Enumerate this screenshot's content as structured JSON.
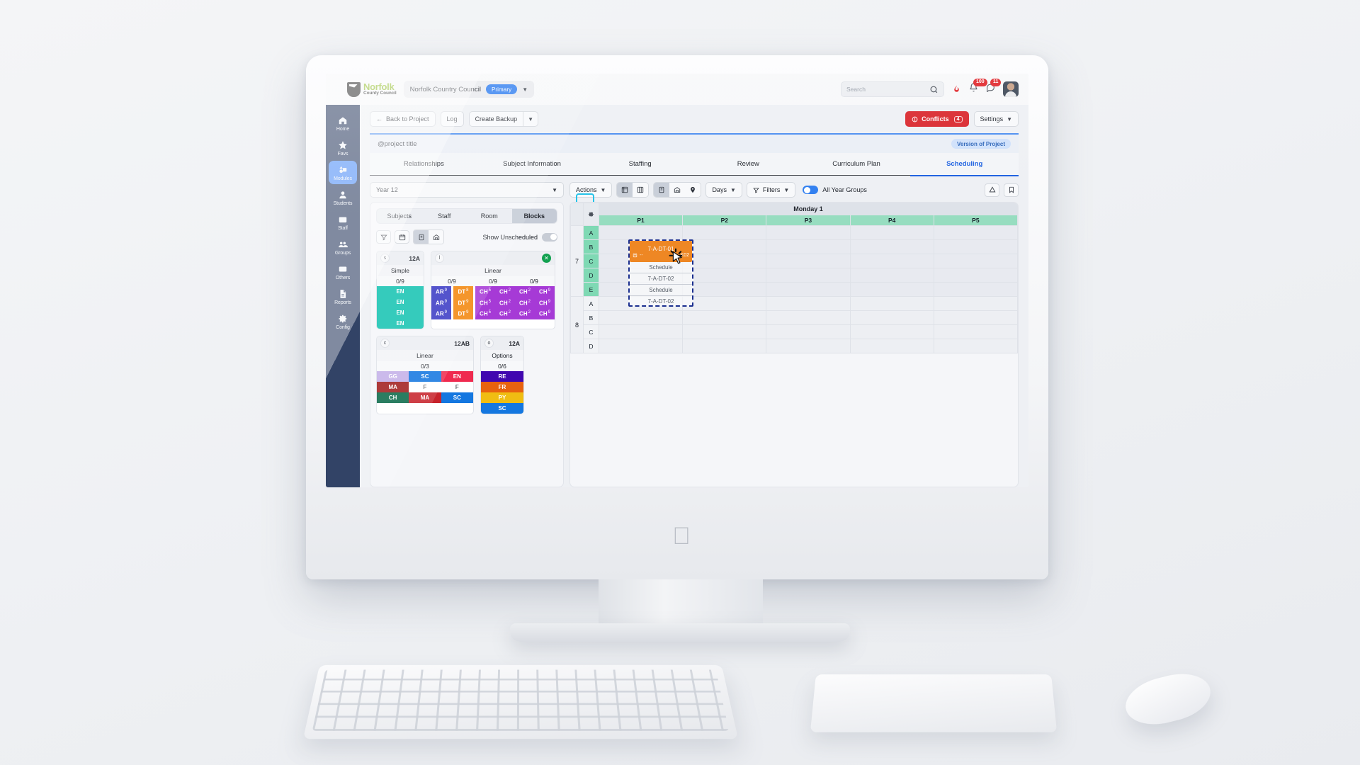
{
  "header": {
    "brand_top": "Norfolk",
    "brand_sub": "County Council",
    "org_name": "Norfolk Country Council",
    "org_badge": "Primary",
    "search_placeholder": "Search",
    "notifications_count": "100",
    "messages_count": "11"
  },
  "sidebar": {
    "items": [
      {
        "label": "Home",
        "icon": "home-icon"
      },
      {
        "label": "Favs",
        "icon": "star-icon"
      },
      {
        "label": "Modules",
        "icon": "modules-icon"
      },
      {
        "label": "Students",
        "icon": "student-icon"
      },
      {
        "label": "Staff",
        "icon": "staff-icon"
      },
      {
        "label": "Groups",
        "icon": "groups-icon"
      },
      {
        "label": "Others",
        "icon": "others-icon"
      },
      {
        "label": "Reports",
        "icon": "report-icon"
      },
      {
        "label": "Config",
        "icon": "gear-icon"
      }
    ],
    "active_index": 2
  },
  "actionbar": {
    "back_label": "Back to Project",
    "log_label": "Log",
    "backup_label": "Create Backup",
    "conflicts_label": "Conflicts",
    "conflicts_count": "4",
    "settings_label": "Settings"
  },
  "project": {
    "title": "@project title",
    "version_label": "Version of Project"
  },
  "tabs": {
    "items": [
      "Relationships",
      "Subject Information",
      "Staffing",
      "Review",
      "Curriculum Plan",
      "Scheduling"
    ],
    "active_index": 5
  },
  "left_panel": {
    "year_select": "Year 12",
    "segments": [
      "Subjects",
      "Staff",
      "Room",
      "Blocks"
    ],
    "segment_active_index": 3,
    "show_unscheduled_label": "Show Unscheduled",
    "show_unscheduled_on": false,
    "blocks": [
      {
        "mark": "S",
        "code": "12A",
        "type": "Simple",
        "counts": [
          "0/9"
        ],
        "closable": false,
        "columns": 1,
        "rows": [
          [
            {
              "text": "EN",
              "color": "#17c3b2"
            }
          ],
          [
            {
              "text": "EN",
              "color": "#17c3b2"
            }
          ],
          [
            {
              "text": "EN",
              "color": "#17c3b2"
            }
          ],
          [
            {
              "text": "EN",
              "color": "#17c3b2"
            }
          ]
        ]
      },
      {
        "mark": "L",
        "code": "",
        "type": "Linear",
        "counts": [
          "0/9",
          "0/9",
          "0/9"
        ],
        "closable": true,
        "columns": 6,
        "rows": [
          [
            {
              "text": "AR",
              "sup": "9",
              "color": "#3b3bc4"
            },
            {
              "text": "DT",
              "sup": "8",
              "color": "#f2860d"
            },
            {
              "text": "CH",
              "sup": "5",
              "color": "#a63ad6"
            },
            {
              "text": "CH",
              "sup": "2",
              "color": "#a63ad6"
            },
            {
              "text": "CH",
              "sup": "2",
              "color": "#a63ad6"
            },
            {
              "text": "CH",
              "sup": "9",
              "color": "#a63ad6"
            }
          ],
          [
            {
              "text": "AR",
              "sup": "9",
              "color": "#3b3bc4"
            },
            {
              "text": "DT",
              "sup": "9",
              "color": "#f2860d"
            },
            {
              "text": "CH",
              "sup": "5",
              "color": "#a63ad6"
            },
            {
              "text": "CH",
              "sup": "2",
              "color": "#a63ad6"
            },
            {
              "text": "CH",
              "sup": "2",
              "color": "#a63ad6"
            },
            {
              "text": "CH",
              "sup": "9",
              "color": "#a63ad6"
            }
          ],
          [
            {
              "text": "AR",
              "sup": "9",
              "color": "#3b3bc4"
            },
            {
              "text": "DT",
              "sup": "9",
              "color": "#f2860d"
            },
            {
              "text": "CH",
              "sup": "5",
              "color": "#a63ad6"
            },
            {
              "text": "CH",
              "sup": "2",
              "color": "#a63ad6"
            },
            {
              "text": "CH",
              "sup": "2",
              "color": "#a63ad6"
            },
            {
              "text": "CH",
              "sup": "9",
              "color": "#a63ad6"
            }
          ]
        ]
      },
      {
        "mark": "C",
        "code": "12AB",
        "type": "Linear",
        "counts": [
          "0/3"
        ],
        "closable": false,
        "columns": 3,
        "rows": [
          [
            {
              "text": "GG",
              "color": "#c3b0e8"
            },
            {
              "text": "SC",
              "color": "#1477e0"
            },
            {
              "text": "EN",
              "color": "#ef2a4f"
            }
          ],
          [
            {
              "text": "MA",
              "color": "#a11d1d"
            },
            {
              "text": "F",
              "color": "#ffffff"
            },
            {
              "text": "F",
              "color": "#ffffff"
            }
          ],
          [
            {
              "text": "CH",
              "color": "#0b6a4a"
            },
            {
              "text": "MA",
              "color": "#c7232b"
            },
            {
              "text": "SC",
              "color": "#1477e0"
            }
          ]
        ]
      },
      {
        "mark": "O",
        "code": "12A",
        "type": "Options",
        "counts": [
          "0/6"
        ],
        "closable": false,
        "columns": 1,
        "rows": [
          [
            {
              "text": "RE",
              "color": "#4107b0"
            }
          ],
          [
            {
              "text": "FR",
              "color": "#e8620f"
            }
          ],
          [
            {
              "text": "PY",
              "color": "#f0bd12"
            }
          ],
          [
            {
              "text": "SC",
              "color": "#1477e0"
            }
          ]
        ]
      }
    ]
  },
  "scheduling_toolbar": {
    "actions_label": "Actions",
    "days_label": "Days",
    "filters_label": "Filters",
    "all_year_groups_label": "All Year Groups",
    "all_year_groups_on": true,
    "view_icons": [
      "grid-view-icon",
      "column-view-icon"
    ],
    "mode_icons": [
      "class-view-icon",
      "room-view-icon",
      "location-pin-icon"
    ],
    "right_icons": [
      "print-icon",
      "bookmark-icon"
    ]
  },
  "timetable": {
    "day_label": "Monday 1",
    "periods": [
      "P1",
      "P2",
      "P3",
      "P4",
      "P5"
    ],
    "year_groups": [
      {
        "year": "7",
        "rows": [
          "A",
          "B",
          "C",
          "D",
          "E"
        ],
        "highlighted": true
      },
      {
        "year": "8",
        "rows": [
          "A",
          "B",
          "C",
          "D"
        ],
        "highlighted": false
      }
    ],
    "dragged_block": {
      "title": "7-A-DT-01",
      "room": "K02",
      "ghost_lines": [
        "Schedule",
        "7-A-DT-02",
        "Schedule",
        "7-A-DT-02"
      ],
      "color": "#ee8724"
    }
  },
  "colors": {
    "accent": "#2f7ef0",
    "danger": "#d9262c",
    "sidebar": "#14274f",
    "highlight_cyan": "#22c1e8",
    "period_green": "#97ddc0"
  }
}
